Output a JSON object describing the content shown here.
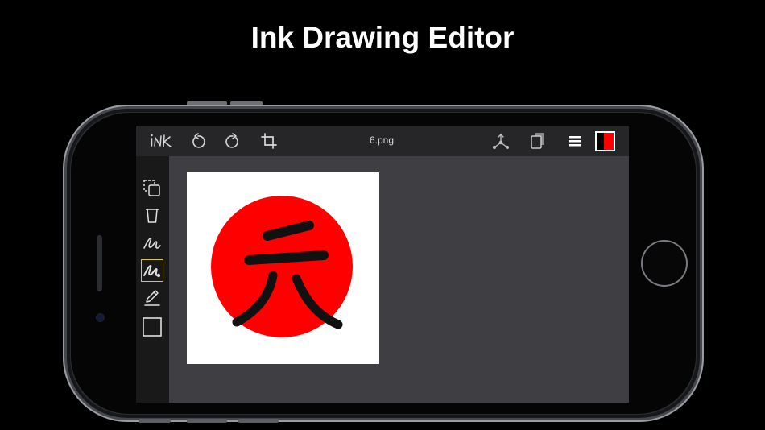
{
  "headline": "Ink Drawing Editor",
  "app": {
    "logo_text": "iNK",
    "file_name": "6.png"
  },
  "toolbar": {
    "left_icons": [
      "ink-logo-icon",
      "undo-icon",
      "redo-icon",
      "crop-icon"
    ],
    "right_icons": [
      "share-icon",
      "layers-icon",
      "menu-icon",
      "color-swatch-icon"
    ]
  },
  "sidebar": {
    "tools": [
      {
        "icon": "copy-select-icon",
        "selected": false
      },
      {
        "icon": "clear-canvas-icon",
        "selected": false
      },
      {
        "icon": "pen-stroke-icon",
        "selected": false
      },
      {
        "icon": "brush-stroke-icon",
        "selected": true
      },
      {
        "icon": "pencil-icon",
        "selected": false
      },
      {
        "icon": "rectangle-icon",
        "selected": false
      }
    ]
  },
  "colors": {
    "primary": "#000000",
    "secondary": "#ff0000",
    "selection": "#d6c64a",
    "canvas_background": "#ffffff",
    "sun": "#ff0000"
  }
}
